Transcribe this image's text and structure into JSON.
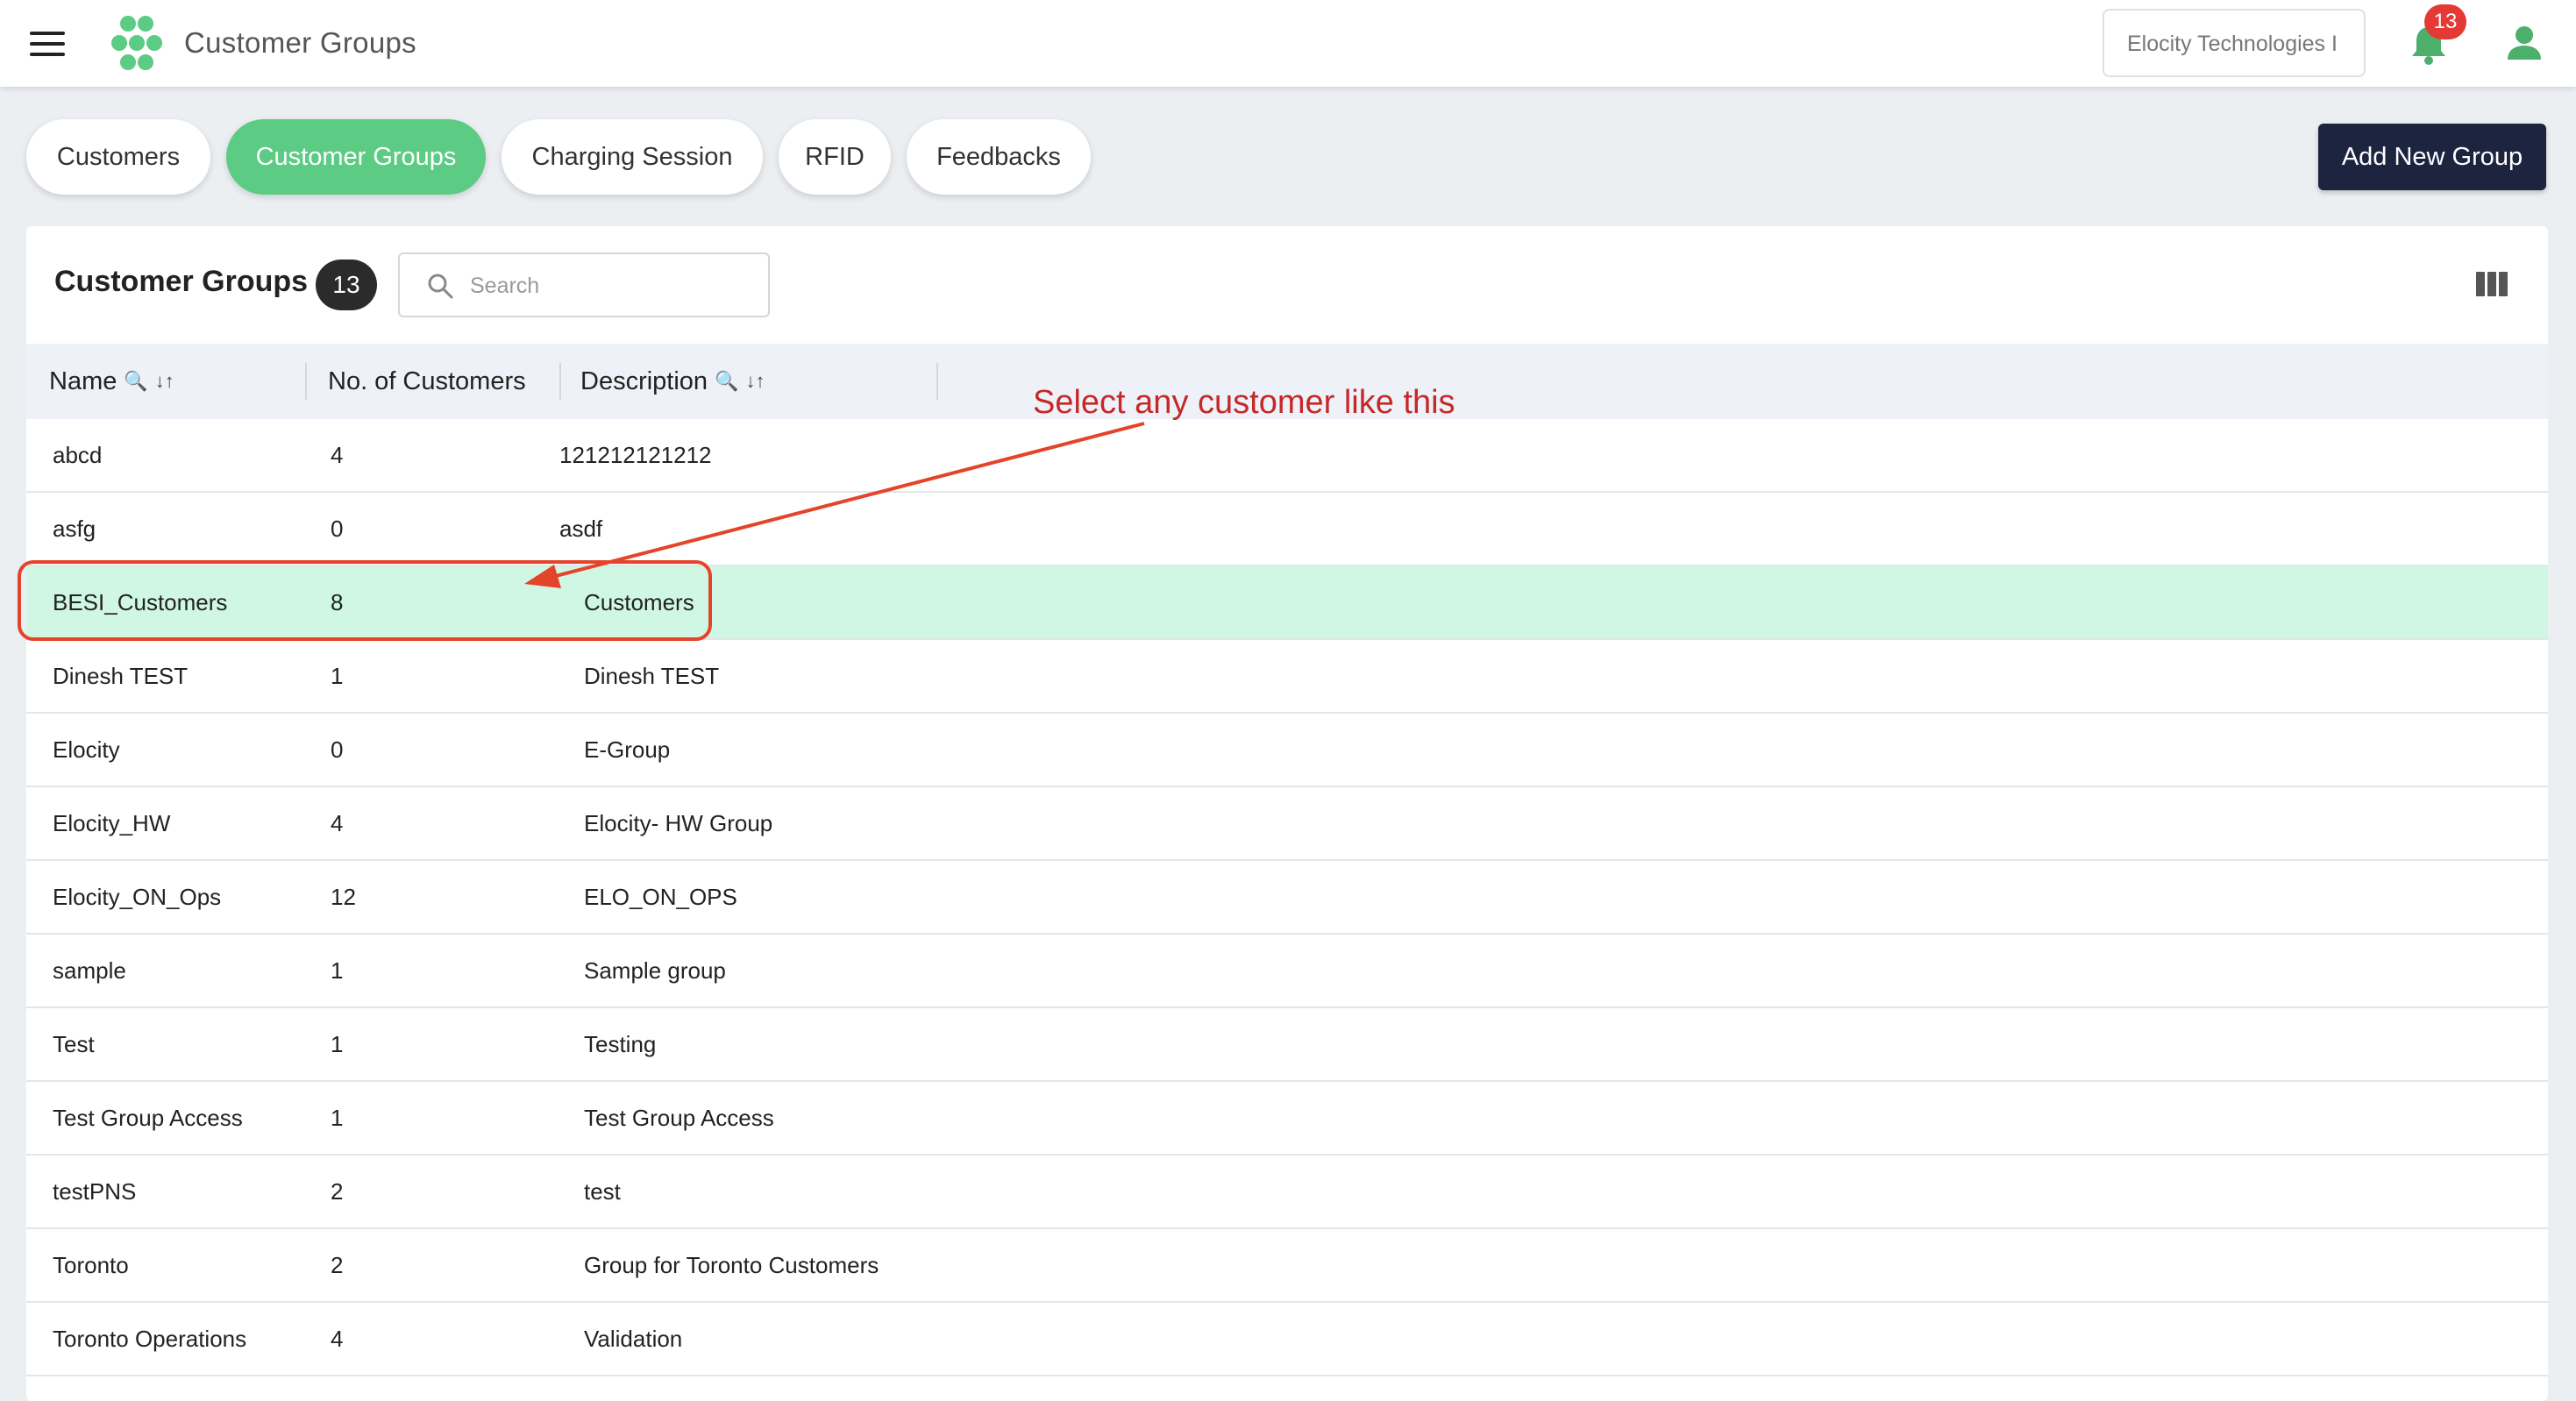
{
  "header": {
    "title": "Customer Groups",
    "org_selector": "Elocity Technologies I",
    "notification_count": "13"
  },
  "tabs": [
    {
      "label": "Customers",
      "active": false
    },
    {
      "label": "Customer Groups",
      "active": true
    },
    {
      "label": "Charging Session",
      "active": false
    },
    {
      "label": "RFID",
      "active": false
    },
    {
      "label": "Feedbacks",
      "active": false
    }
  ],
  "add_button": "Add New Group",
  "panel": {
    "title": "Customer Groups",
    "count": "13",
    "search_placeholder": "Search"
  },
  "table": {
    "columns": [
      "Name",
      "No. of Customers",
      "Description"
    ],
    "sort_icon": "↓↑",
    "rows": [
      {
        "name": "abcd",
        "customers": "4",
        "description": "121212121212"
      },
      {
        "name": "asfg",
        "customers": "0",
        "description": "asdf"
      },
      {
        "name": "BESI_Customers",
        "customers": "8",
        "description": "Customers"
      },
      {
        "name": "Dinesh TEST",
        "customers": "1",
        "description": "Dinesh TEST"
      },
      {
        "name": "Elocity",
        "customers": "0",
        "description": "E-Group"
      },
      {
        "name": "Elocity_HW",
        "customers": "4",
        "description": "Elocity- HW Group"
      },
      {
        "name": "Elocity_ON_Ops",
        "customers": "12",
        "description": "ELO_ON_OPS"
      },
      {
        "name": "sample",
        "customers": "1",
        "description": "Sample group"
      },
      {
        "name": "Test",
        "customers": "1",
        "description": "Testing"
      },
      {
        "name": "Test Group Access",
        "customers": "1",
        "description": "Test Group Access"
      },
      {
        "name": "testPNS",
        "customers": "2",
        "description": "test"
      },
      {
        "name": "Toronto",
        "customers": "2",
        "description": "Group for Toronto Customers"
      },
      {
        "name": "Toronto Operations",
        "customers": "4",
        "description": "Validation"
      }
    ]
  },
  "annotation": {
    "text": "Select any customer like this",
    "color": "#c62828"
  },
  "colors": {
    "accent_green": "#5ccb84",
    "highlight_row": "#d0f7e4",
    "dark_button": "#1c2440",
    "badge_red": "#e53935"
  }
}
